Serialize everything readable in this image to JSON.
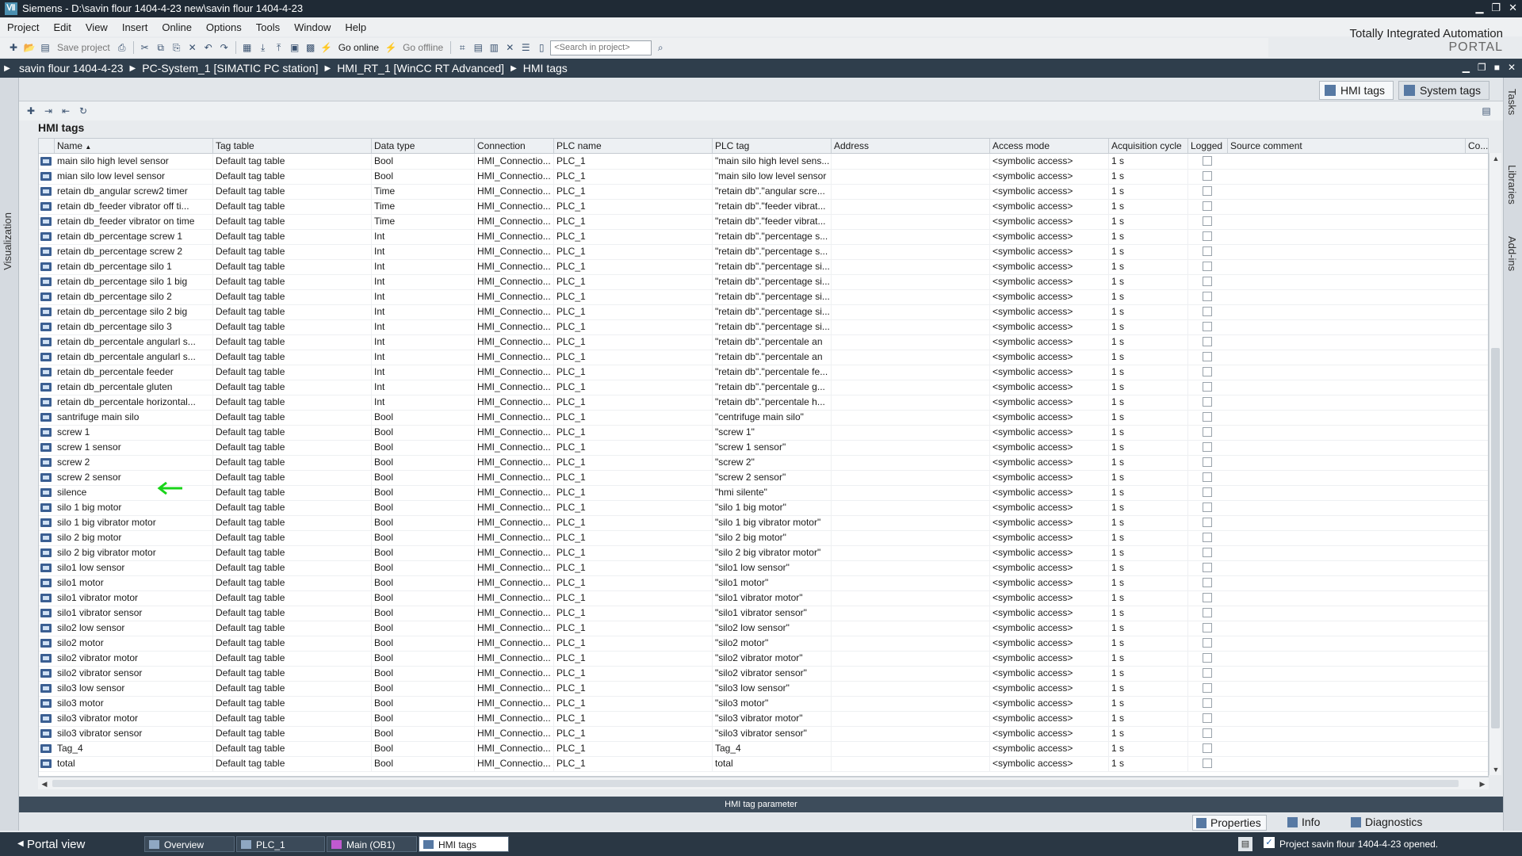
{
  "window": {
    "title": "Siemens  -  D:\\savin flour 1404-4-23 new\\savin flour 1404-4-23",
    "logo": "Ⅶ"
  },
  "menu": [
    "Project",
    "Edit",
    "View",
    "Insert",
    "Online",
    "Options",
    "Tools",
    "Window",
    "Help"
  ],
  "brand": {
    "line1": "Totally Integrated Automation",
    "line2": "PORTAL"
  },
  "toolbar": {
    "save_project": "Save project",
    "go_online": "Go online",
    "go_offline": "Go offline",
    "search_placeholder": "<Search in project>"
  },
  "breadcrumb": [
    "savin flour 1404-4-23",
    "PC-System_1 [SIMATIC PC station]",
    "HMI_RT_1 [WinCC RT Advanced]",
    "HMI tags"
  ],
  "side_tabs": {
    "left": "Visualization",
    "right": [
      "Tasks",
      "Libraries",
      "Add-ins"
    ]
  },
  "editor_tabs": [
    "HMI tags",
    "System tags"
  ],
  "panel_title": "HMI tags",
  "columns": [
    "Name",
    "Tag table",
    "Data type",
    "Connection",
    "PLC name",
    "PLC tag",
    "Address",
    "Access mode",
    "Acquisition cycle",
    "Logged",
    "Source comment",
    "Co..."
  ],
  "rows": [
    [
      "main silo high level sensor",
      "Default tag table",
      "Bool",
      "HMI_Connectio...",
      "PLC_1",
      "\"main silo high level sens...",
      "",
      "<symbolic access>",
      "1 s"
    ],
    [
      "mian silo low level sensor",
      "Default tag table",
      "Bool",
      "HMI_Connectio...",
      "PLC_1",
      "\"main silo low level sensor",
      "",
      "<symbolic access>",
      "1 s"
    ],
    [
      "retain db_angular screw2 timer",
      "Default tag table",
      "Time",
      "HMI_Connectio...",
      "PLC_1",
      "\"retain db\".\"angular scre...",
      "",
      "<symbolic access>",
      "1 s"
    ],
    [
      "retain db_feeder vibrator off ti...",
      "Default tag table",
      "Time",
      "HMI_Connectio...",
      "PLC_1",
      "\"retain db\".\"feeder vibrat...",
      "",
      "<symbolic access>",
      "1 s"
    ],
    [
      "retain db_feeder vibrator on time",
      "Default tag table",
      "Time",
      "HMI_Connectio...",
      "PLC_1",
      "\"retain db\".\"feeder vibrat...",
      "",
      "<symbolic access>",
      "1 s"
    ],
    [
      "retain db_percentage screw 1",
      "Default tag table",
      "Int",
      "HMI_Connectio...",
      "PLC_1",
      "\"retain db\".\"percentage s...",
      "",
      "<symbolic access>",
      "1 s"
    ],
    [
      "retain db_percentage screw 2",
      "Default tag table",
      "Int",
      "HMI_Connectio...",
      "PLC_1",
      "\"retain db\".\"percentage s...",
      "",
      "<symbolic access>",
      "1 s"
    ],
    [
      "retain db_percentage silo 1",
      "Default tag table",
      "Int",
      "HMI_Connectio...",
      "PLC_1",
      "\"retain db\".\"percentage si...",
      "",
      "<symbolic access>",
      "1 s"
    ],
    [
      "retain db_percentage silo 1 big",
      "Default tag table",
      "Int",
      "HMI_Connectio...",
      "PLC_1",
      "\"retain db\".\"percentage si...",
      "",
      "<symbolic access>",
      "1 s"
    ],
    [
      "retain db_percentage silo 2",
      "Default tag table",
      "Int",
      "HMI_Connectio...",
      "PLC_1",
      "\"retain db\".\"percentage si...",
      "",
      "<symbolic access>",
      "1 s"
    ],
    [
      "retain db_percentage silo 2 big",
      "Default tag table",
      "Int",
      "HMI_Connectio...",
      "PLC_1",
      "\"retain db\".\"percentage si...",
      "",
      "<symbolic access>",
      "1 s"
    ],
    [
      "retain db_percentage silo 3",
      "Default tag table",
      "Int",
      "HMI_Connectio...",
      "PLC_1",
      "\"retain db\".\"percentage si...",
      "",
      "<symbolic access>",
      "1 s"
    ],
    [
      "retain db_percentale angularl s...",
      "Default tag table",
      "Int",
      "HMI_Connectio...",
      "PLC_1",
      "\"retain db\".\"percentale an",
      "",
      "<symbolic access>",
      "1 s"
    ],
    [
      "retain db_percentale angularl s...",
      "Default tag table",
      "Int",
      "HMI_Connectio...",
      "PLC_1",
      "\"retain db\".\"percentale an",
      "",
      "<symbolic access>",
      "1 s"
    ],
    [
      "retain db_percentale feeder",
      "Default tag table",
      "Int",
      "HMI_Connectio...",
      "PLC_1",
      "\"retain db\".\"percentale fe...",
      "",
      "<symbolic access>",
      "1 s"
    ],
    [
      "retain db_percentale gluten",
      "Default tag table",
      "Int",
      "HMI_Connectio...",
      "PLC_1",
      "\"retain db\".\"percentale g...",
      "",
      "<symbolic access>",
      "1 s"
    ],
    [
      "retain db_percentale horizontal...",
      "Default tag table",
      "Int",
      "HMI_Connectio...",
      "PLC_1",
      "\"retain db\".\"percentale h...",
      "",
      "<symbolic access>",
      "1 s"
    ],
    [
      "santrifuge main silo",
      "Default tag table",
      "Bool",
      "HMI_Connectio...",
      "PLC_1",
      "\"centrifuge main silo\"",
      "",
      "<symbolic access>",
      "1 s"
    ],
    [
      "screw 1",
      "Default tag table",
      "Bool",
      "HMI_Connectio...",
      "PLC_1",
      "\"screw 1\"",
      "",
      "<symbolic access>",
      "1 s"
    ],
    [
      "screw 1 sensor",
      "Default tag table",
      "Bool",
      "HMI_Connectio...",
      "PLC_1",
      "\"screw 1 sensor\"",
      "",
      "<symbolic access>",
      "1 s"
    ],
    [
      "screw 2",
      "Default tag table",
      "Bool",
      "HMI_Connectio...",
      "PLC_1",
      "\"screw 2\"",
      "",
      "<symbolic access>",
      "1 s"
    ],
    [
      "screw 2 sensor",
      "Default tag table",
      "Bool",
      "HMI_Connectio...",
      "PLC_1",
      "\"screw 2 sensor\"",
      "",
      "<symbolic access>",
      "1 s"
    ],
    [
      "silence",
      "Default tag table",
      "Bool",
      "HMI_Connectio...",
      "PLC_1",
      "\"hmi silente\"",
      "",
      "<symbolic access>",
      "1 s"
    ],
    [
      "silo 1 big motor",
      "Default tag table",
      "Bool",
      "HMI_Connectio...",
      "PLC_1",
      "\"silo 1 big motor\"",
      "",
      "<symbolic access>",
      "1 s"
    ],
    [
      "silo 1 big vibrator motor",
      "Default tag table",
      "Bool",
      "HMI_Connectio...",
      "PLC_1",
      "\"silo 1 big vibrator motor\"",
      "",
      "<symbolic access>",
      "1 s"
    ],
    [
      "silo 2 big motor",
      "Default tag table",
      "Bool",
      "HMI_Connectio...",
      "PLC_1",
      "\"silo 2 big motor\"",
      "",
      "<symbolic access>",
      "1 s"
    ],
    [
      "silo 2 big vibrator motor",
      "Default tag table",
      "Bool",
      "HMI_Connectio...",
      "PLC_1",
      "\"silo 2 big vibrator motor\"",
      "",
      "<symbolic access>",
      "1 s"
    ],
    [
      "silo1 low sensor",
      "Default tag table",
      "Bool",
      "HMI_Connectio...",
      "PLC_1",
      "\"silo1 low sensor\"",
      "",
      "<symbolic access>",
      "1 s"
    ],
    [
      "silo1 motor",
      "Default tag table",
      "Bool",
      "HMI_Connectio...",
      "PLC_1",
      "\"silo1 motor\"",
      "",
      "<symbolic access>",
      "1 s"
    ],
    [
      "silo1 vibrator motor",
      "Default tag table",
      "Bool",
      "HMI_Connectio...",
      "PLC_1",
      "\"silo1 vibrator motor\"",
      "",
      "<symbolic access>",
      "1 s"
    ],
    [
      "silo1 vibrator sensor",
      "Default tag table",
      "Bool",
      "HMI_Connectio...",
      "PLC_1",
      "\"silo1 vibrator sensor\"",
      "",
      "<symbolic access>",
      "1 s"
    ],
    [
      "silo2 low sensor",
      "Default tag table",
      "Bool",
      "HMI_Connectio...",
      "PLC_1",
      "\"silo2 low sensor\"",
      "",
      "<symbolic access>",
      "1 s"
    ],
    [
      "silo2 motor",
      "Default tag table",
      "Bool",
      "HMI_Connectio...",
      "PLC_1",
      "\"silo2 motor\"",
      "",
      "<symbolic access>",
      "1 s"
    ],
    [
      "silo2 vibrator motor",
      "Default tag table",
      "Bool",
      "HMI_Connectio...",
      "PLC_1",
      "\"silo2 vibrator motor\"",
      "",
      "<symbolic access>",
      "1 s"
    ],
    [
      "silo2 vibrator sensor",
      "Default tag table",
      "Bool",
      "HMI_Connectio...",
      "PLC_1",
      "\"silo2 vibrator sensor\"",
      "",
      "<symbolic access>",
      "1 s"
    ],
    [
      "silo3 low sensor",
      "Default tag table",
      "Bool",
      "HMI_Connectio...",
      "PLC_1",
      "\"silo3 low sensor\"",
      "",
      "<symbolic access>",
      "1 s"
    ],
    [
      "silo3 motor",
      "Default tag table",
      "Bool",
      "HMI_Connectio...",
      "PLC_1",
      "\"silo3 motor\"",
      "",
      "<symbolic access>",
      "1 s"
    ],
    [
      "silo3 vibrator motor",
      "Default tag table",
      "Bool",
      "HMI_Connectio...",
      "PLC_1",
      "\"silo3 vibrator motor\"",
      "",
      "<symbolic access>",
      "1 s"
    ],
    [
      "silo3 vibrator sensor",
      "Default tag table",
      "Bool",
      "HMI_Connectio...",
      "PLC_1",
      "\"silo3 vibrator sensor\"",
      "",
      "<symbolic access>",
      "1 s"
    ],
    [
      "Tag_4",
      "Default tag table",
      "Bool",
      "HMI_Connectio...",
      "PLC_1",
      "Tag_4",
      "",
      "<symbolic access>",
      "1 s"
    ],
    [
      "total",
      "Default tag table",
      "Bool",
      "HMI_Connectio...",
      "PLC_1",
      "total",
      "",
      "<symbolic access>",
      "1 s"
    ]
  ],
  "inspector_title": "HMI tag parameter",
  "property_tabs": [
    "Properties",
    "Info",
    "Diagnostics"
  ],
  "statusbar": {
    "portal_view": "Portal view",
    "tabs": [
      "Overview",
      "PLC_1",
      "Main (OB1)",
      "HMI tags"
    ],
    "message": "Project savin flour 1404-4-23 opened."
  },
  "colors": {
    "accent": "#2f3e4c",
    "highlight_arrow": "#19d419"
  }
}
